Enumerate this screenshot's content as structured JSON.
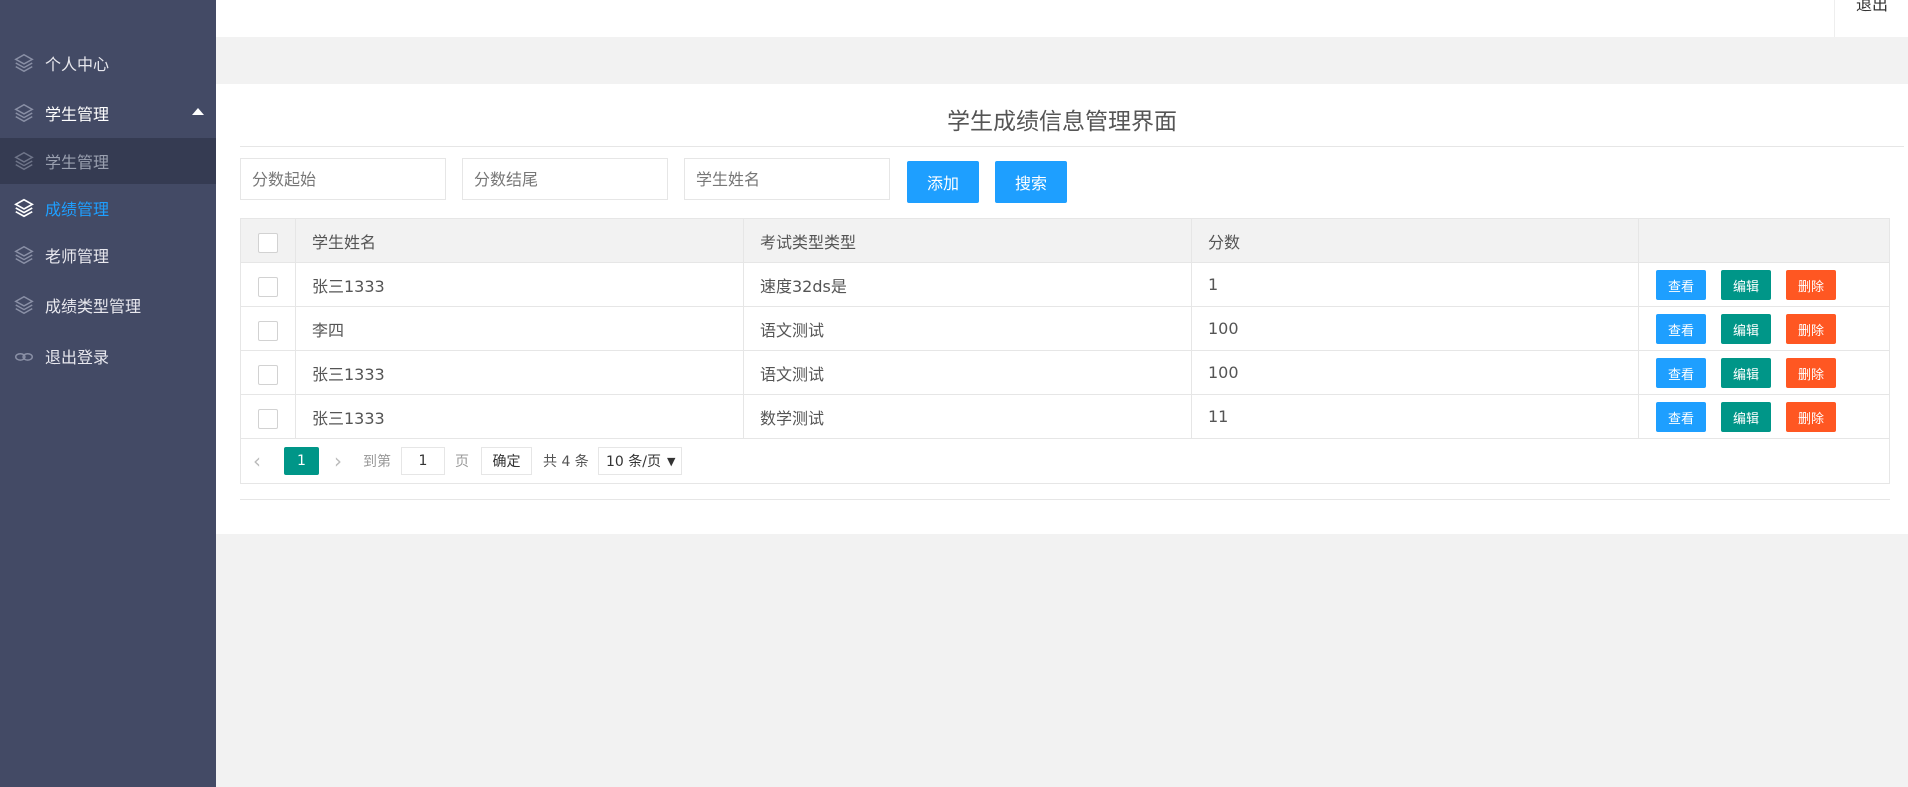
{
  "header": {
    "logout_label": "退出"
  },
  "sidebar": {
    "items": [
      {
        "label": "个人中心"
      },
      {
        "label": "学生管理"
      },
      {
        "label": "学生管理"
      },
      {
        "label": "成绩管理"
      },
      {
        "label": "老师管理"
      },
      {
        "label": "成绩类型管理"
      },
      {
        "label": "退出登录"
      }
    ]
  },
  "main": {
    "title": "学生成绩信息管理界面",
    "search": {
      "score_start_placeholder": "分数起始",
      "score_end_placeholder": "分数结尾",
      "name_placeholder": "学生姓名",
      "add_label": "添加",
      "search_label": "搜索"
    },
    "table": {
      "headers": [
        "学生姓名",
        "考试类型类型",
        "分数"
      ],
      "rows": [
        {
          "name": "张三1333",
          "type": "速度32ds是",
          "score": "1"
        },
        {
          "name": "李四",
          "type": "语文测试",
          "score": "100"
        },
        {
          "name": "张三1333",
          "type": "语文测试",
          "score": "100"
        },
        {
          "name": "张三1333",
          "type": "数学测试",
          "score": "11"
        }
      ],
      "actions": {
        "view": "查看",
        "edit": "编辑",
        "delete": "删除"
      }
    },
    "pagination": {
      "current_page": "1",
      "goto_label": "到第",
      "goto_value": "1",
      "page_unit": "页",
      "confirm_label": "确定",
      "total_label": "共 4 条",
      "page_size": "10 条/页"
    }
  }
}
